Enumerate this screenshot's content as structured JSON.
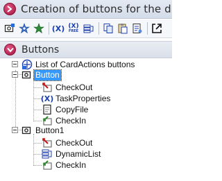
{
  "window": {
    "title": "Creation of buttons for the d"
  },
  "toolbar": {
    "items": [
      {
        "name": "add-button-icon"
      },
      {
        "name": "settings-star-icon"
      },
      {
        "name": "pin-star-icon"
      },
      {
        "name": "variable-x-icon",
        "text": "(X)"
      },
      {
        "name": "variable-free-icon",
        "text": "(X)",
        "sub": "FREE"
      },
      {
        "name": "list-icon"
      },
      {
        "name": "copy-icon"
      },
      {
        "name": "paste-icon"
      },
      {
        "name": "properties-icon"
      },
      {
        "name": "open-external-icon"
      }
    ]
  },
  "panel": {
    "title": "Buttons"
  },
  "tree": {
    "root": {
      "label": "List of CardActions buttons",
      "icon": "buttons-list-icon"
    },
    "groups": [
      {
        "label": "Button",
        "selected": true,
        "icon": "button-icon",
        "children": [
          {
            "label": "CheckOut",
            "icon": "checkout-icon"
          },
          {
            "label": "TaskProperties",
            "icon": "variable-x-icon"
          },
          {
            "label": "CopyFile",
            "icon": "copy-file-icon"
          },
          {
            "label": "CheckIn",
            "icon": "checkin-icon"
          }
        ]
      },
      {
        "label": "Button1",
        "selected": false,
        "icon": "button-icon",
        "children": [
          {
            "label": "CheckOut",
            "icon": "checkout-icon"
          },
          {
            "label": "DynamicList",
            "icon": "list-icon"
          },
          {
            "label": "CheckIn",
            "icon": "checkin-icon"
          }
        ]
      }
    ]
  },
  "colors": {
    "accent": "#a1123e",
    "selection": "#3399ff",
    "header_bg": "#d9e0ea"
  }
}
